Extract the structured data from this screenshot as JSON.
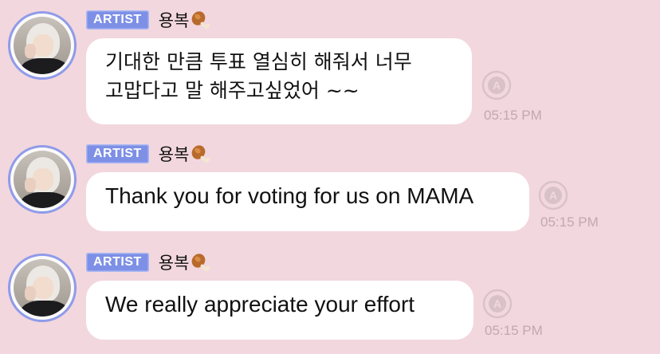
{
  "messages": [
    {
      "badge": "ARTIST",
      "sender": "용복",
      "lines": [
        "기대한 만큼 투표 열심히 해줘서 너무",
        "고맙다고 말 해주고싶었어 ~~"
      ],
      "time": "05:15 PM"
    },
    {
      "badge": "ARTIST",
      "sender": "용복",
      "lines": [
        "Thank you for voting for us on MAMA"
      ],
      "time": "05:15 PM"
    },
    {
      "badge": "ARTIST",
      "sender": "용복",
      "lines": [
        "We really appreciate your effort"
      ],
      "time": "05:15 PM"
    }
  ],
  "icons": {
    "sender_emoji": "drumstick-icon",
    "translate": "translate-icon"
  },
  "colors": {
    "background": "#f2d7de",
    "badge": "#7e8fe6",
    "avatar_ring": "#8f9bea",
    "timestamp": "#c1a9ae"
  }
}
